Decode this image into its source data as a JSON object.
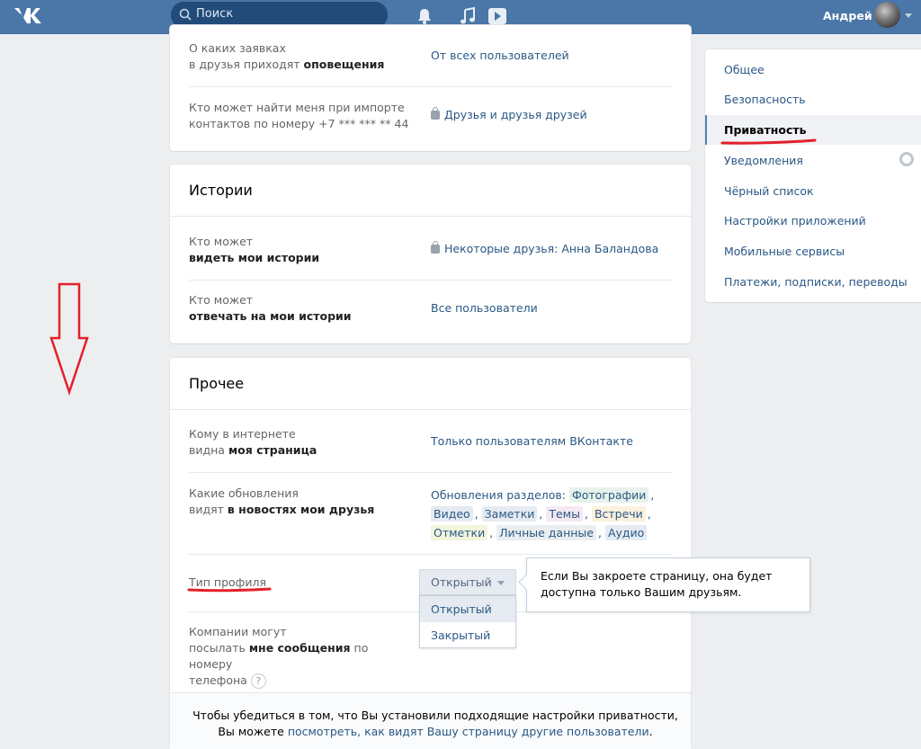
{
  "header": {
    "search_placeholder": "Поиск",
    "user_name": "Андрей",
    "brand_color": "#4a76a8"
  },
  "sections": {
    "friends": {
      "rows": [
        {
          "label_prefix": "О каких заявках",
          "label_line2": "в друзья приходят ",
          "label_bold": "оповещения",
          "value": "От всех пользователей",
          "locked": false
        },
        {
          "label_prefix": "Кто может найти меня при импорте",
          "label_line2": "контактов по номеру +7 *** *** ** 44",
          "label_bold": "",
          "value": "Друзья и друзья друзей",
          "locked": true
        }
      ]
    },
    "stories": {
      "title": "Истории",
      "rows": [
        {
          "label_prefix": "Кто может",
          "label_bold": "видеть мои истории",
          "value": "Некоторые друзья: Анна Баландова",
          "locked": true
        },
        {
          "label_prefix": "Кто может",
          "label_bold": "отвечать на мои истории",
          "value": "Все пользователи",
          "locked": false
        }
      ]
    },
    "other": {
      "title": "Прочее",
      "rows": [
        {
          "label_prefix": "Кому в интернете",
          "label_line2": "видна ",
          "label_bold": "моя страница",
          "value": "Только пользователям ВКонтакте"
        },
        {
          "label_prefix": "Какие обновления",
          "label_line2": "видят ",
          "label_bold": "в новостях мои друзья",
          "value_prefix": "Обновления разделов:"
        }
      ],
      "tags": [
        {
          "text": "Фотографии",
          "color": "#e6f2ea"
        },
        {
          "text": "Видео",
          "color": "#e5ebf1"
        },
        {
          "text": "Заметки",
          "color": "#e5ebf1"
        },
        {
          "text": "Темы",
          "color": "#f4e9f3"
        },
        {
          "text": "Встречи",
          "color": "#fbf1dd"
        },
        {
          "text": "Отметки",
          "color": "#f1f5dc"
        },
        {
          "text": "Личные данные",
          "color": "#ebeef0"
        },
        {
          "text": "Аудио",
          "color": "#e5ebf1"
        }
      ],
      "profile_type": {
        "label": "Тип профиля",
        "selected": "Открытый",
        "options": [
          "Открытый",
          "Закрытый"
        ],
        "tooltip": "Если Вы закроете страницу, она будет доступна только Вашим друзьям."
      },
      "companies": {
        "line1": "Компании могут",
        "line2_prefix": "посылать ",
        "line2_bold": "мне сообщения",
        "line2_suffix": " по номеру",
        "line3": "телефона",
        "help": "?"
      }
    }
  },
  "footer": {
    "line1": "Чтобы убедиться в том, что Вы установили подходящие настройки приватности,",
    "line2_prefix": "Вы можете ",
    "link": "посмотреть, как видят Вашу страницу другие пользователи",
    "line2_suffix": "."
  },
  "sidebar": {
    "items": [
      {
        "label": "Общее"
      },
      {
        "label": "Безопасность"
      },
      {
        "label": "Приватность",
        "active": true
      },
      {
        "label": "Уведомления"
      },
      {
        "label": "Чёрный список"
      },
      {
        "label": "Настройки приложений"
      },
      {
        "label": "Мобильные сервисы"
      },
      {
        "label": "Платежи, подписки, переводы"
      }
    ]
  },
  "annotation_color": "#e3202a"
}
